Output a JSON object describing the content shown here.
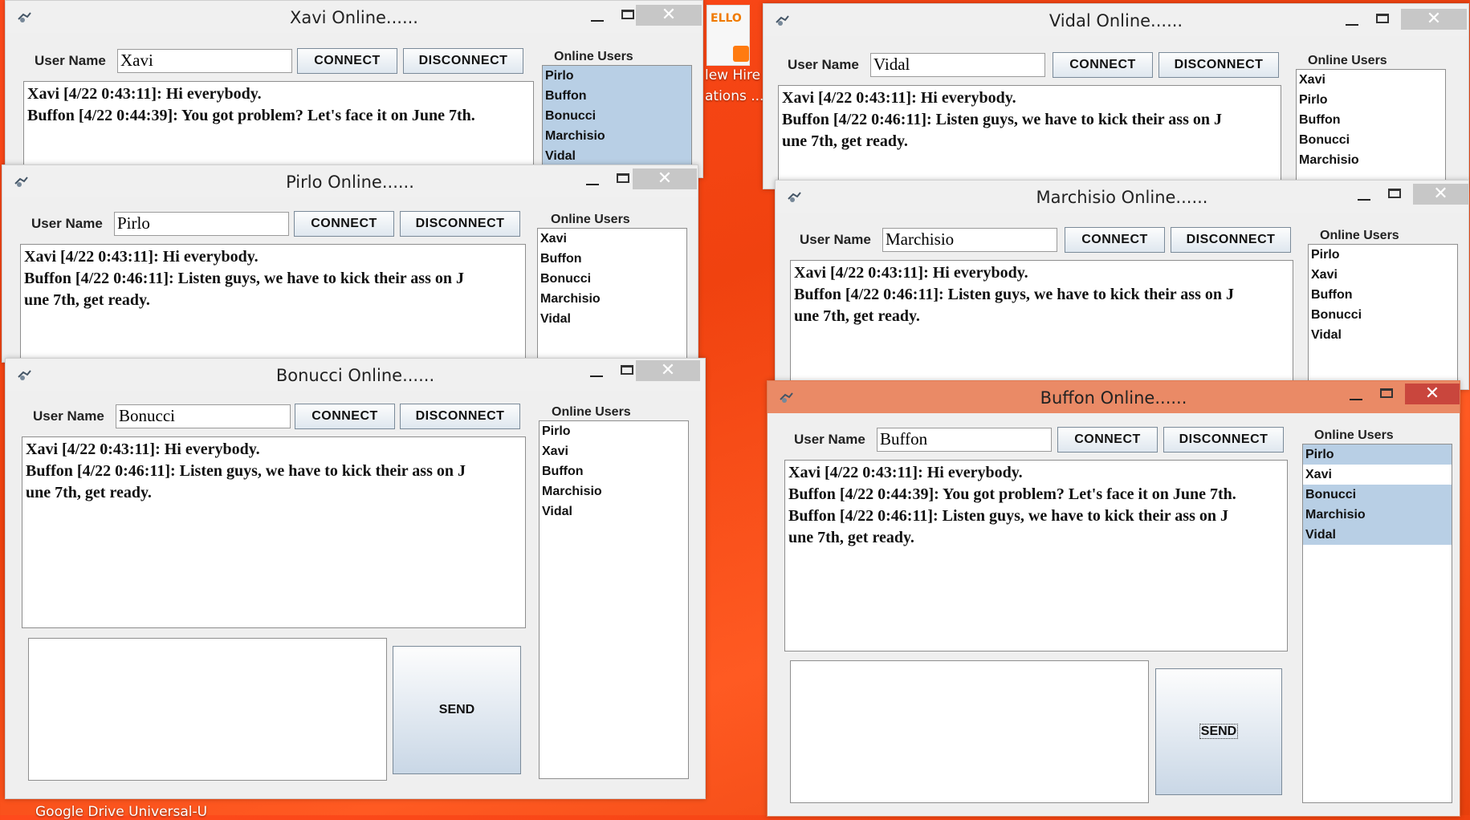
{
  "desktop": {
    "tile_label": "ELLO",
    "side_text_1": "lew Hire",
    "side_text_2": "ations ...",
    "taskbar_text": "Google Drive  Universal-U"
  },
  "common": {
    "user_name_label": "User Name",
    "connect_label": "CONNECT",
    "disconnect_label": "DISCONNECT",
    "online_users_label": "Online Users",
    "send_label": "SEND",
    "close_glyph": "✕"
  },
  "windows": {
    "xavi": {
      "title": "Xavi  Online......",
      "user_name": "Xavi",
      "online_users": [
        "Pirlo",
        "Buffon",
        "Bonucci",
        "Marchisio",
        "Vidal"
      ],
      "chat": [
        "Xavi [4/22 0:43:11]: Hi everybody.",
        "Buffon [4/22 0:44:39]: You got problem? Let's face it on June 7th."
      ]
    },
    "pirlo": {
      "title": "Pirlo  Online......",
      "user_name": "Pirlo",
      "online_users": [
        "Xavi",
        "Buffon",
        "Bonucci",
        "Marchisio",
        "Vidal"
      ],
      "chat": [
        "Xavi [4/22 0:43:11]: Hi everybody.",
        "Buffon [4/22 0:46:11]: Listen guys, we have to kick their ass on J",
        "une 7th, get ready."
      ]
    },
    "bonucci": {
      "title": "Bonucci  Online......",
      "user_name": "Bonucci",
      "online_users": [
        "Pirlo",
        "Xavi",
        "Buffon",
        "Marchisio",
        "Vidal"
      ],
      "chat": [
        "Xavi [4/22 0:43:11]: Hi everybody.",
        "Buffon [4/22 0:46:11]: Listen guys, we have to kick their ass on J",
        "une 7th, get ready."
      ]
    },
    "vidal": {
      "title": "Vidal  Online......",
      "user_name": "Vidal",
      "online_users": [
        "Xavi",
        "Pirlo",
        "Buffon",
        "Bonucci",
        "Marchisio"
      ],
      "chat": [
        "Xavi [4/22 0:43:11]: Hi everybody.",
        "Buffon [4/22 0:46:11]: Listen guys, we have to kick their ass on J",
        "une 7th, get ready."
      ]
    },
    "marchisio": {
      "title": "Marchisio  Online......",
      "user_name": "Marchisio",
      "online_users": [
        "Pirlo",
        "Xavi",
        "Buffon",
        "Bonucci",
        "Vidal"
      ],
      "chat": [
        "Xavi [4/22 0:43:11]: Hi everybody.",
        "Buffon [4/22 0:46:11]: Listen guys, we have to kick their ass on J",
        "une 7th, get ready."
      ]
    },
    "buffon": {
      "title": "Buffon  Online......",
      "user_name": "Buffon",
      "online_users": [
        "Pirlo",
        "Xavi",
        "Bonucci",
        "Marchisio",
        "Vidal"
      ],
      "chat": [
        "Xavi [4/22 0:43:11]: Hi everybody.",
        "Buffon [4/22 0:44:39]: You got problem? Let's face it on June 7th.",
        "Buffon [4/22 0:46:11]: Listen guys, we have to kick their ass on J",
        "une 7th, get ready."
      ]
    }
  },
  "colors": {
    "desktop": "#f0420f",
    "active_titlebar": "#ea8a66",
    "active_close": "#c9463d",
    "selection": "#b8cfe5"
  }
}
